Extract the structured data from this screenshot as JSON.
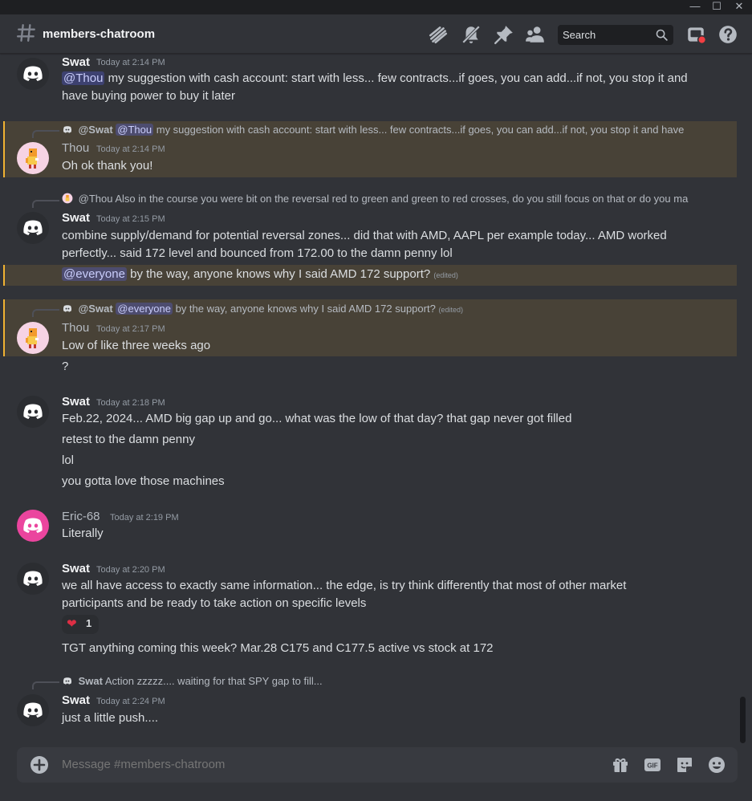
{
  "window": {
    "minimize": "—",
    "maximize": "☐",
    "close": "✕"
  },
  "header": {
    "channel": "members-chatroom",
    "search_label": "Search",
    "icons": [
      "threads-icon",
      "notification-muted-icon",
      "pin-icon",
      "members-icon",
      "search-icon",
      "inbox-icon",
      "help-icon"
    ]
  },
  "messages": [
    {
      "author": "Swat",
      "time": "Today at 2:14 PM",
      "mention": "@Thou",
      "text": "my suggestion with cash account: start with less... few contracts...if goes, you can add...if not, you stop it and",
      "text2": "have buying power to buy it later"
    },
    {
      "reply_to": {
        "author": "@Swat",
        "mention": "@Thou",
        "text": "my suggestion with cash account: start with less... few contracts...if goes, you can add...if not, you stop it and have"
      },
      "author": "Thou",
      "time": "Today at 2:14 PM",
      "text": "Oh ok thank you!"
    },
    {
      "reply_to": {
        "author": "@Thou",
        "text": "Also in the course you were bit on the reversal red to green and green to red crosses, do you still focus on that or do you ma"
      },
      "author": "Swat",
      "time": "Today at 2:15 PM",
      "text": "combine supply/demand for potential reversal zones... did that with AMD, AAPL per example today... AMD worked",
      "text2": "perfectly... said 172 level and bounced from 172.00 to the damn penny lol",
      "followup_mention": "@everyone",
      "followup": "by the way, anyone knows why I said AMD 172 support?",
      "followup_edited": "(edited)"
    },
    {
      "reply_to": {
        "author": "@Swat",
        "mention": "@everyone",
        "text": "by the way, anyone knows why I said AMD 172 support?",
        "edited": "(edited)"
      },
      "author": "Thou",
      "time": "Today at 2:17 PM",
      "text": "Low of like three weeks ago",
      "followup": "?"
    },
    {
      "author": "Swat",
      "time": "Today at 2:18 PM",
      "lines": [
        "Feb.22, 2024... AMD big gap up and go... what was the low of that day? that gap never got filled",
        "retest to the damn penny",
        "lol",
        "you gotta love those machines"
      ]
    },
    {
      "author": "Eric-68",
      "time": "Today at 2:19 PM",
      "text": "Literally"
    },
    {
      "author": "Swat",
      "time": "Today at 2:20 PM",
      "text": "we all have access to exactly same information... the edge, is try think differently that most of other market",
      "text2": "participants and be ready to take action on specific levels",
      "reaction": {
        "emoji": "heart",
        "count": "1"
      },
      "followup": "TGT anything coming this week? Mar.28 C175 and C177.5 active vs stock at 172"
    },
    {
      "reply_to": {
        "author": "Swat",
        "text": "Action zzzzz.... waiting for that SPY gap to fill..."
      },
      "author": "Swat",
      "time": "Today at 2:24 PM",
      "text": "just a little push...."
    }
  ],
  "composer": {
    "placeholder": "Message #members-chatroom"
  },
  "colors": {
    "background": "#313338",
    "highlight": "#f0b232",
    "mention": "#5865f2",
    "heart": "#dd2e44",
    "eric_avatar": "#eb459e"
  }
}
